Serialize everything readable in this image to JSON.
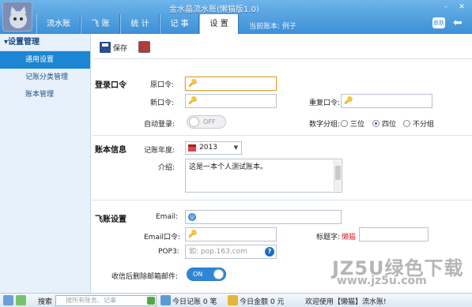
{
  "window": {
    "title": "金水晶流水账(懒猫版1.0)"
  },
  "tabs": [
    {
      "label": "流水账"
    },
    {
      "label": "飞 账"
    },
    {
      "label": "统 计"
    },
    {
      "label": "记 事"
    },
    {
      "label": "设 置"
    }
  ],
  "current_account": "当前账本: 例子",
  "header_icons": {
    "skin": "皮肤",
    "back": "back-arrow-icon"
  },
  "sidebar": {
    "header": "设置管理",
    "items": [
      {
        "label": "通用设置"
      },
      {
        "label": "记账分类管理"
      },
      {
        "label": "账本管理"
      }
    ]
  },
  "toolbar": {
    "save_label": "保存",
    "print_icon": "print-icon"
  },
  "login": {
    "section": "登录口令",
    "old_pw_label": "原口令:",
    "new_pw_label": "新口令:",
    "repeat_pw_label": "重复口令:",
    "autologin_label": "自动登录:",
    "autologin_state": "OFF",
    "digit_group_label": "数字分组:",
    "digit_options": [
      "三位",
      "四位",
      "不分组"
    ],
    "digit_selected": "四位"
  },
  "account": {
    "section": "账本信息",
    "year_label": "记账年度:",
    "year_value": "2013",
    "intro_label": "介绍:",
    "intro_value": "这是一本个人测试账本。"
  },
  "fly": {
    "section": "飞账设置",
    "email_label": "Email:",
    "email_pw_label": "Email口令:",
    "tag_label": "标题字:",
    "tag_value": "懒猫",
    "pop3_label": "POP3:",
    "pop3_placeholder": "如: pop.163.com",
    "delete_after_label": "收信后删除邮箱邮件:",
    "delete_after_state": "ON"
  },
  "statusbar": {
    "search_label": "搜索",
    "search_placeholder": "搜所有账务、记事",
    "today_count": "今日记账 0 笔",
    "today_amount": "今日金额 0 元",
    "welcome": "欢迎使用【懒猫】流水账!"
  },
  "watermark": {
    "line1": "JZ5U绿色下载",
    "line2": "www.jz5u.com"
  },
  "colors": {
    "titlebar": "#3d8fd6",
    "sidebar_active": "#1c86d4",
    "toggle_on": "#2e87d6",
    "tag_text": "#e0202a"
  }
}
